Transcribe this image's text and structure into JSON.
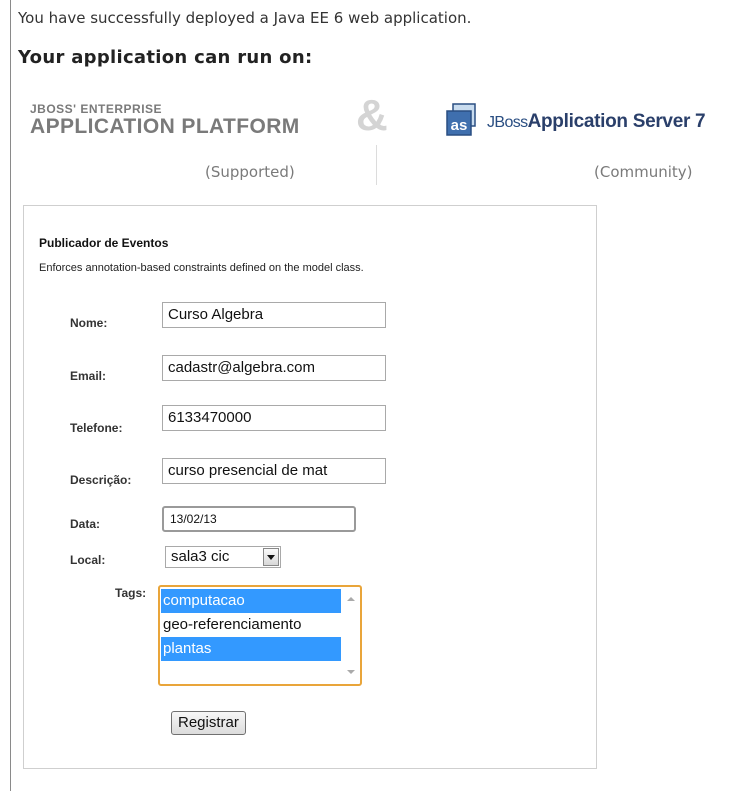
{
  "header": {
    "intro": "You have successfully deployed a Java EE 6 web application.",
    "run_on": "Your application can run on:"
  },
  "platforms": {
    "eap_line1": "JBOSS' ENTERPRISE",
    "eap_line2": "APPLICATION PLATFORM",
    "eap_status": "(Supported)",
    "ampersand": "&",
    "as_logo_text": "as",
    "as_brand": "JBoss",
    "as_name": "Application Server 7",
    "as_status": "(Community)"
  },
  "form": {
    "title": "Publicador de Eventos",
    "description": "Enforces annotation-based constraints defined on the model class.",
    "fields": {
      "nome": {
        "label": "Nome:",
        "value": "Curso Algebra"
      },
      "email": {
        "label": "Email:",
        "value": "cadastr@algebra.com"
      },
      "telefone": {
        "label": "Telefone:",
        "value": "6133470000"
      },
      "descricao": {
        "label": "Descrição:",
        "value": "curso presencial de mat"
      },
      "data": {
        "label": "Data:",
        "value": "13/02/13"
      },
      "local": {
        "label": "Local:",
        "selected": "sala3 cic"
      },
      "tags": {
        "label": "Tags:",
        "options": [
          {
            "label": "computacao",
            "selected": true
          },
          {
            "label": "geo-referenciamento",
            "selected": false
          },
          {
            "label": "plantas",
            "selected": true
          }
        ]
      }
    },
    "submit_label": "Registrar"
  },
  "colors": {
    "selection": "#3399ff",
    "focus_border": "#e9a53a",
    "as_blue": "#2a4e82"
  }
}
